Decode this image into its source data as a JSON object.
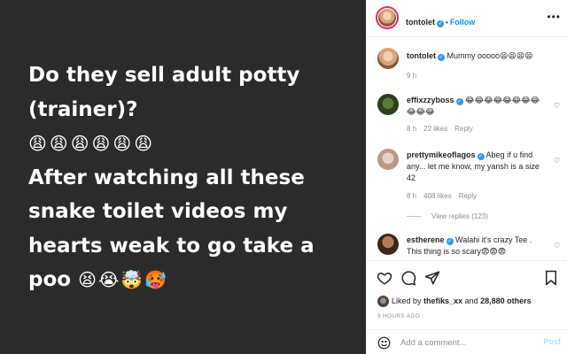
{
  "post": {
    "text_lines": [
      "Do they sell adult potty",
      "(trainer)?",
      "😩😩😩😩😩😩",
      "After watching all these",
      "snake toilet videos my",
      "hearts weak to go take a",
      "poo"
    ],
    "trailing_emojis": "😫😭🤯🥵"
  },
  "header": {
    "username": "tontolet",
    "dot": "•",
    "follow_label": "Follow",
    "more": "•••"
  },
  "comments": [
    {
      "username": "tontolet",
      "text": "Mummy ooooo😫😫😫😫",
      "time": "9 h"
    },
    {
      "username": "effixzzyboss",
      "text": "😂😂😂😂😂😂😂😂😂😂😂",
      "time": "8 h",
      "likes": "22 likes",
      "reply": "Reply"
    },
    {
      "username": "prettymikeoflagos",
      "text": "Abeg if u find any... let me know, my yansh is a size 42",
      "time": "8 h",
      "likes": "408 likes",
      "reply": "Reply",
      "view_replies": "View replies (123)"
    },
    {
      "username": "estherene",
      "text": "Walahi it's crazy Tee . This thing is so scary😨😨😨"
    }
  ],
  "likes": {
    "prefix": "Liked by",
    "user": "thefiks_xx",
    "middle": "and",
    "count": "28,880 others"
  },
  "time_ago": "9 HOURS AGO",
  "add_comment": {
    "placeholder": "Add a comment...",
    "post_label": "Post"
  },
  "icons": [
    "heart-icon",
    "comment-icon",
    "share-icon",
    "bookmark-icon",
    "smile-icon",
    "more-icon",
    "verified-icon"
  ],
  "colors": {
    "accent": "#0095f6",
    "verified": "#3897f0",
    "post_bg": "#2b2b2b"
  }
}
